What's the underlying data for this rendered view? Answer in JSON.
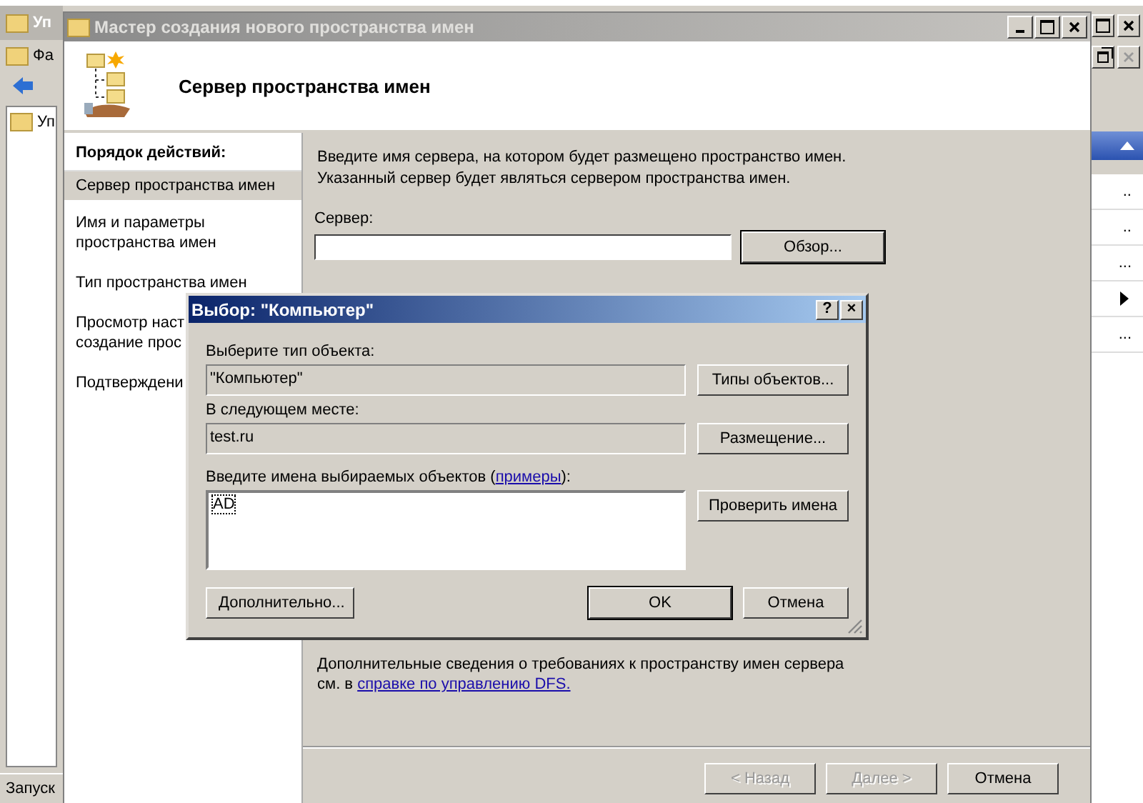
{
  "background_window": {
    "title": "Уп",
    "menu": [
      "Фа"
    ],
    "tree": [
      {
        "label": "Уп"
      }
    ],
    "actions": [
      {
        "kind": "more",
        "text": ".."
      },
      {
        "kind": "more",
        "text": ".."
      },
      {
        "kind": "more",
        "text": "..."
      },
      {
        "kind": "submenu"
      },
      {
        "kind": "more",
        "text": "..."
      }
    ],
    "status_bar": "Запуск"
  },
  "wizard": {
    "title": "Мастер создания нового пространства имен",
    "heading": "Сервер пространства имен",
    "steps_header": "Порядок действий:",
    "steps": [
      {
        "label": "Сервер пространства имен",
        "selected": true
      },
      {
        "label": "Имя и параметры пространства имен",
        "selected": false
      },
      {
        "label": "Тип пространства имен",
        "selected": false
      },
      {
        "label": "Просмотр наст\nсоздание прос",
        "selected": false
      },
      {
        "label": "Подтверждени",
        "selected": false
      }
    ],
    "intro": "Введите имя сервера, на котором будет размещено пространство имен. Указанный сервер будет являться сервером пространства имен.",
    "server_label": "Сервер:",
    "browse_button": "Обзор...",
    "footer_text": "Дополнительные сведения о требованиях к пространству имен сервера см. в",
    "footer_link": "справке по управлению DFS.",
    "buttons": [
      {
        "label": "< Назад",
        "disabled": true
      },
      {
        "label": "Далее >",
        "disabled": true
      },
      {
        "label": "Отмена",
        "disabled": false
      }
    ]
  },
  "dialog": {
    "title": "Выбор: \"Компьютер\"",
    "help": "?",
    "close": "×",
    "object_type_label": "Выберите тип объекта:",
    "object_type": "\"Компьютер\"",
    "object_types_button": "Типы объектов...",
    "location_label": "В следующем месте:",
    "location": "test.ru",
    "location_button": "Размещение...",
    "names_label": "Введите имена выбираемых объектов (",
    "names_link": "примеры",
    "names_label_end": "):",
    "names_value": "AD",
    "check_button": "Проверить имена",
    "advanced_button": "Дополнительно...",
    "ok_button": "OK",
    "cancel_button": "Отмена"
  }
}
